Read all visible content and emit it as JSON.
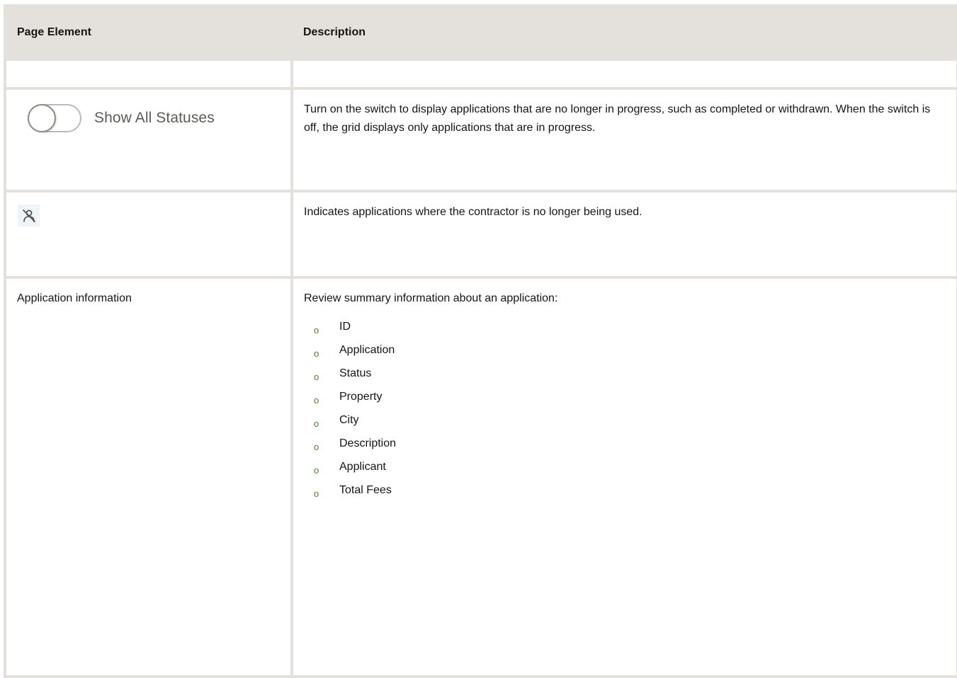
{
  "table": {
    "headers": [
      "Page Element",
      "Description"
    ],
    "rows": [
      {
        "element": "",
        "description": ""
      },
      {
        "element_toggle_label": "Show All Statuses",
        "description": "Turn on the switch to display applications that are no longer in progress, such as completed or withdrawn. When the switch is off, the grid displays only applications that are in progress."
      },
      {
        "element_icon": "contractor-not-used-icon",
        "description": "Indicates applications where the contractor is no longer being used."
      },
      {
        "element": "Application information",
        "description": "Review summary information about an application:",
        "bullet_glyph": "o",
        "fields": [
          "ID",
          "Application",
          "Status",
          "Property",
          "City",
          "Description",
          "Applicant",
          "Total Fees"
        ]
      }
    ]
  },
  "colors": {
    "border": "#e4e1dc",
    "bullet": "#4a7f2a",
    "icon_bg": "#eef4f8"
  }
}
